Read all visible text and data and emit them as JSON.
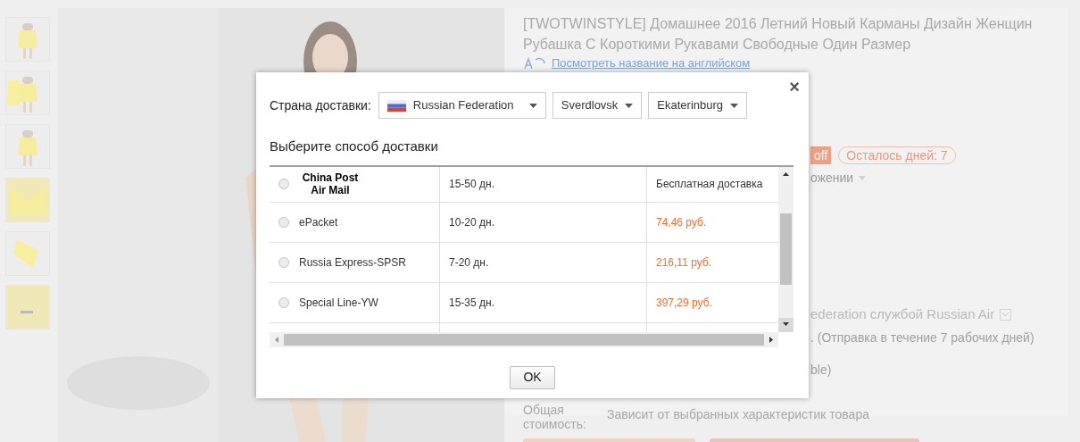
{
  "product": {
    "title": "[TWOTWINSTYLE] Домашнее 2016 Летний Новый Карманы Дизайн Женщин Рубашка С Короткими Рукавами Свободные Один Размер",
    "english_link": "Посмотреть название на английском",
    "discount_badge": "off",
    "days_left": "Осталось дней: 7",
    "installment_fragment": "ожении",
    "shipping_fragment": "ederation службой Russian Air",
    "dispatch_note": ". (Отправка в течение 7 рабочих дней)",
    "availability_fragment": "ble)",
    "total_label": "Общая стоимость:",
    "total_value": "Зависит от выбранных характеристик товара"
  },
  "dialog": {
    "country_label": "Страна доставки:",
    "selects": [
      {
        "kind": "country",
        "value": "Russian Federation"
      },
      {
        "kind": "plain",
        "value": "Sverdlovsk"
      },
      {
        "kind": "plain",
        "value": "Ekaterinburg"
      }
    ],
    "heading": "Выберите способ доставки",
    "rows": [
      {
        "kind": "logo",
        "name": "China Post Air Mail",
        "time": "15-50 дн.",
        "price": "Бесплатная доставка",
        "price_highlighted": false,
        "selected": false
      },
      {
        "kind": "plain",
        "name": "ePacket",
        "time": "10-20 дн.",
        "price": "74,46 руб.",
        "price_highlighted": true,
        "selected": false
      },
      {
        "kind": "plain",
        "name": "Russia Express-SPSR",
        "time": "7-20 дн.",
        "price": "216,11 руб.",
        "price_highlighted": true,
        "selected": false
      },
      {
        "kind": "plain",
        "name": "Special Line-YW",
        "time": "15-35 дн.",
        "price": "397,29 руб.",
        "price_highlighted": true,
        "selected": false
      }
    ],
    "close": "×",
    "ok": "OK"
  }
}
